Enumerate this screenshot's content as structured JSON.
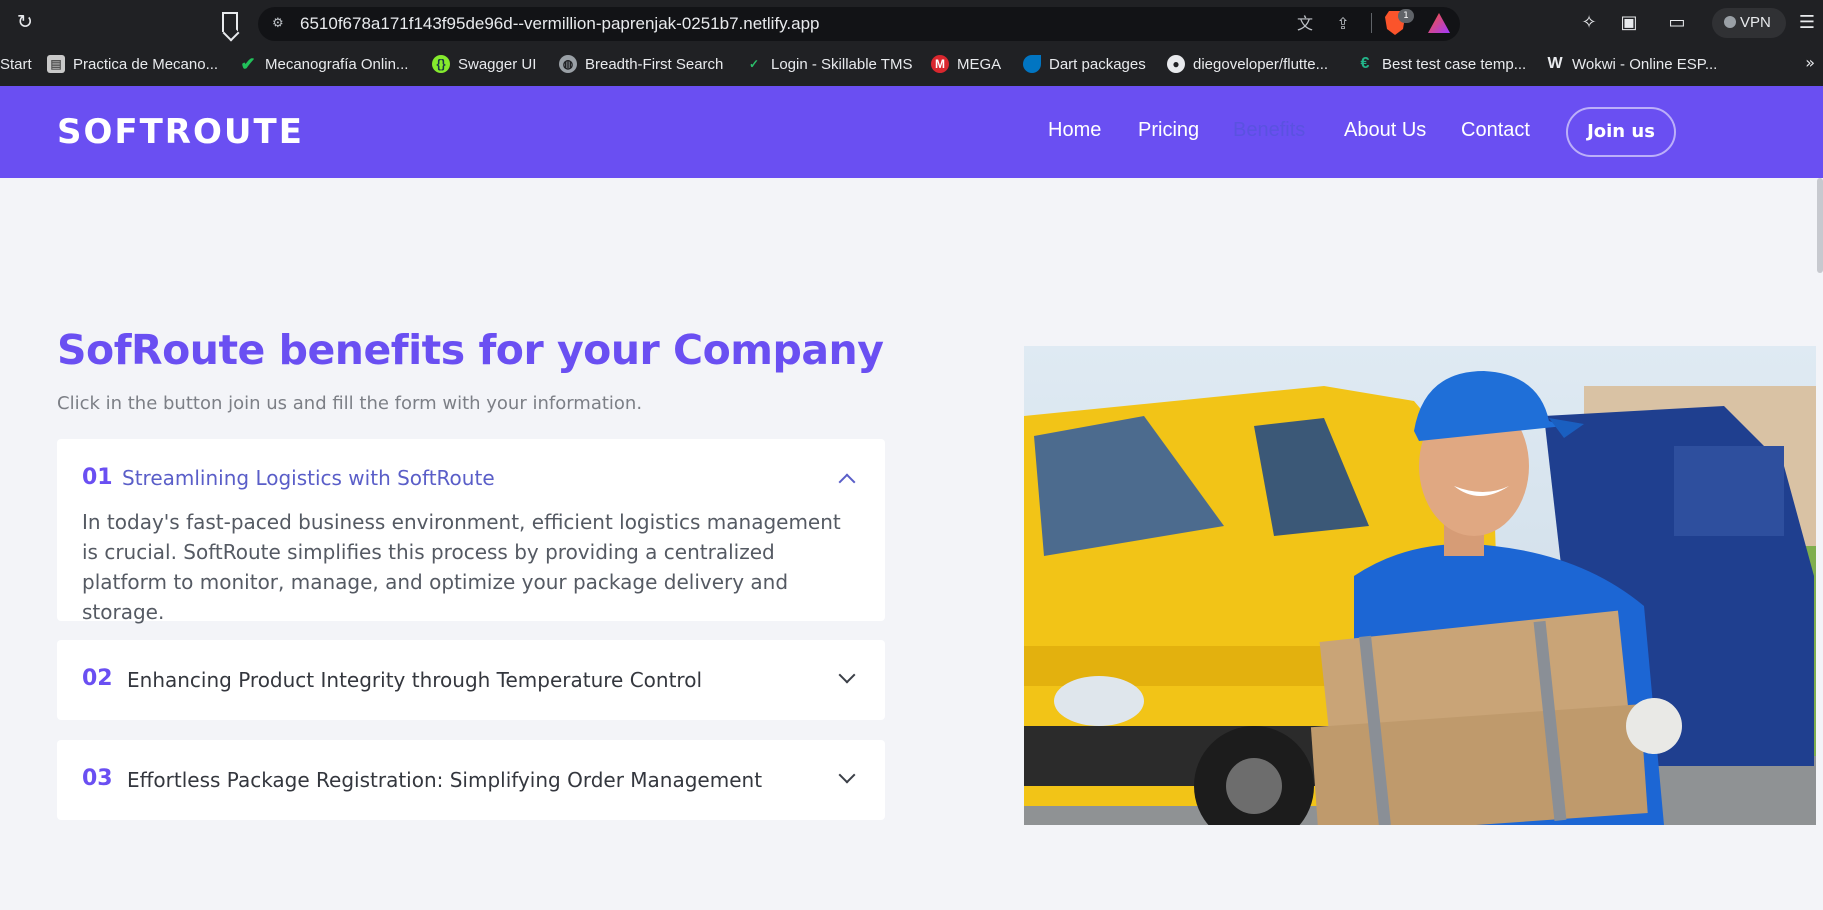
{
  "browser": {
    "url": "6510f678a171f143f95de96d--vermillion-paprenjak-0251b7.netlify.app",
    "vpn_label": "VPN",
    "brave_badge": "1",
    "bookmarks": [
      {
        "label": "Start",
        "icon": "none"
      },
      {
        "label": "Practica de Mecano...",
        "icon": "document-icon"
      },
      {
        "label": "Mecanografía Onlin...",
        "icon": "check-icon"
      },
      {
        "label": "Swagger UI",
        "icon": "swagger-icon"
      },
      {
        "label": "Breadth-First Search",
        "icon": "globe-icon"
      },
      {
        "label": "Login - Skillable TMS",
        "icon": "check-icon"
      },
      {
        "label": "MEGA",
        "icon": "mega-icon"
      },
      {
        "label": "Dart packages",
        "icon": "dart-icon"
      },
      {
        "label": "diegoveloper/flutte...",
        "icon": "github-icon"
      },
      {
        "label": "Best test case temp...",
        "icon": "e-icon"
      },
      {
        "label": "Wokwi - Online ESP...",
        "icon": "wokwi-icon"
      }
    ],
    "bookmarks_overflow": "»"
  },
  "site": {
    "brand": "SOFTROUTE",
    "nav": {
      "home": "Home",
      "pricing": "Pricing",
      "benefits": "Benefits",
      "about": "About Us",
      "contact": "Contact",
      "join": "Join us"
    },
    "colors": {
      "brand": "#6a4ff2",
      "background": "#f3f4f8",
      "active_title": "#5a5ec8"
    }
  },
  "benefits": {
    "headline_prefix": "SofRoute benefits for your ",
    "headline_bold": "Company",
    "subtitle": "Click in the button join us and fill the form with your information.",
    "items": [
      {
        "number": "01",
        "title": "Streamlining Logistics with SoftRoute",
        "expanded": true,
        "body": "In today's fast-paced business environment, efficient logistics management is crucial. SoftRoute simplifies this process by providing a centralized platform to monitor, manage, and optimize your package delivery and storage."
      },
      {
        "number": "02",
        "title": "Enhancing Product Integrity through Temperature Control",
        "expanded": false
      },
      {
        "number": "03",
        "title": "Effortless Package Registration: Simplifying Order Management",
        "expanded": false
      }
    ]
  }
}
